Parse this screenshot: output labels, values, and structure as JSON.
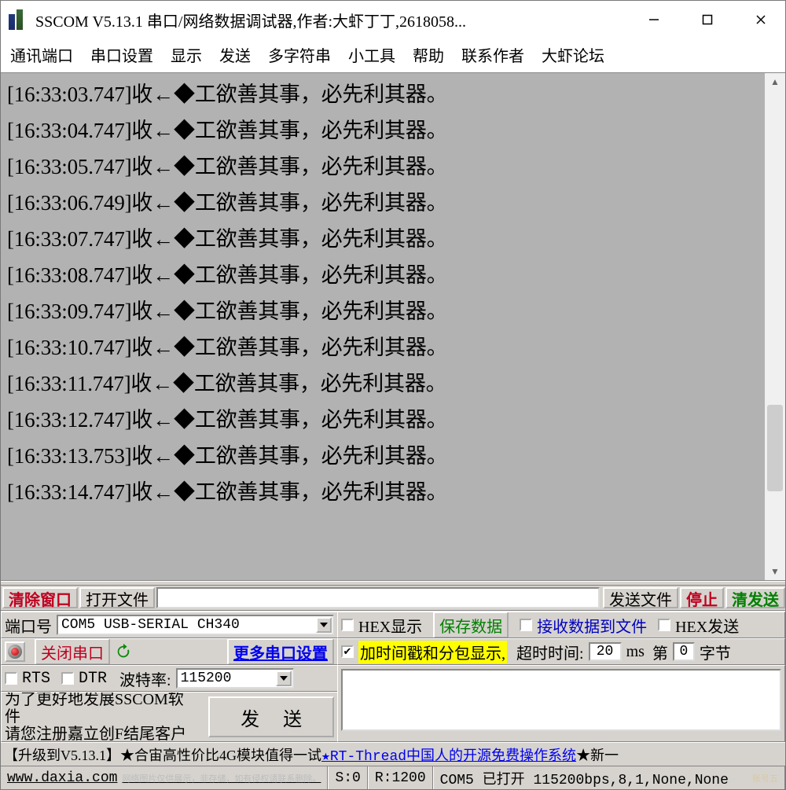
{
  "title": "SSCOM V5.13.1 串口/网络数据调试器,作者:大虾丁丁,2618058...",
  "menu": [
    "通讯端口",
    "串口设置",
    "显示",
    "发送",
    "多字符串",
    "小工具",
    "帮助",
    "联系作者",
    "大虾论坛"
  ],
  "log_lines": [
    "[16:33:03.747]收←◆工欲善其事，必先利其器。",
    "[16:33:04.747]收←◆工欲善其事，必先利其器。",
    "[16:33:05.747]收←◆工欲善其事，必先利其器。",
    "[16:33:06.749]收←◆工欲善其事，必先利其器。",
    "[16:33:07.747]收←◆工欲善其事，必先利其器。",
    "[16:33:08.747]收←◆工欲善其事，必先利其器。",
    "[16:33:09.747]收←◆工欲善其事，必先利其器。",
    "[16:33:10.747]收←◆工欲善其事，必先利其器。",
    "[16:33:11.747]收←◆工欲善其事，必先利其器。",
    "[16:33:12.747]收←◆工欲善其事，必先利其器。",
    "[16:33:13.753]收←◆工欲善其事，必先利其器。",
    "[16:33:14.747]收←◆工欲善其事，必先利其器。"
  ],
  "toolbar": {
    "clear": "清除窗口",
    "open_file": "打开文件",
    "input_value": "",
    "send_file": "发送文件",
    "stop": "停止",
    "clear_send": "清发送"
  },
  "port": {
    "label": "端口号",
    "value": "COM5 USB-SERIAL CH340"
  },
  "hex_show": {
    "label": "HEX显示",
    "checked": false
  },
  "save_data": "保存数据",
  "recv_to_file": {
    "label": "接收数据到文件",
    "checked": false
  },
  "hex_send": {
    "label": "HEX发送",
    "checked": false
  },
  "close_port_btn": "关闭串口",
  "more_settings": "更多串口设置",
  "timestamp_pack": {
    "label": "加时间戳和分包显示,",
    "checked": true
  },
  "timeout": {
    "label": "超时时间:",
    "value": "20",
    "unit": "ms"
  },
  "byte_pos": {
    "label1": "第",
    "value": "0",
    "label2": "字节"
  },
  "rts": {
    "label": "RTS",
    "checked": false
  },
  "dtr": {
    "label": "DTR",
    "checked": false
  },
  "baud": {
    "label": "波特率:",
    "value": "115200"
  },
  "notice": {
    "l1": "为了更好地发展SSCOM软件",
    "l2": "请您注册嘉立创F结尾客户"
  },
  "send_big": "发 送",
  "promo": {
    "upgrade": "【升级到V5.13.1】",
    "p1": "★合宙高性价比4G模块值得一试 ",
    "link": "★RT-Thread中国人的开源免费操作系统",
    "p2": " ★新一"
  },
  "status": {
    "site": "www.daxia.com",
    "s": "S:0",
    "r": "R:1200",
    "info": "COM5 已打开  115200bps,8,1,None,None",
    "wm1": "网络图片仅供展示，非存储，如有侵权请联系删除。",
    "wm2": "账号五"
  }
}
